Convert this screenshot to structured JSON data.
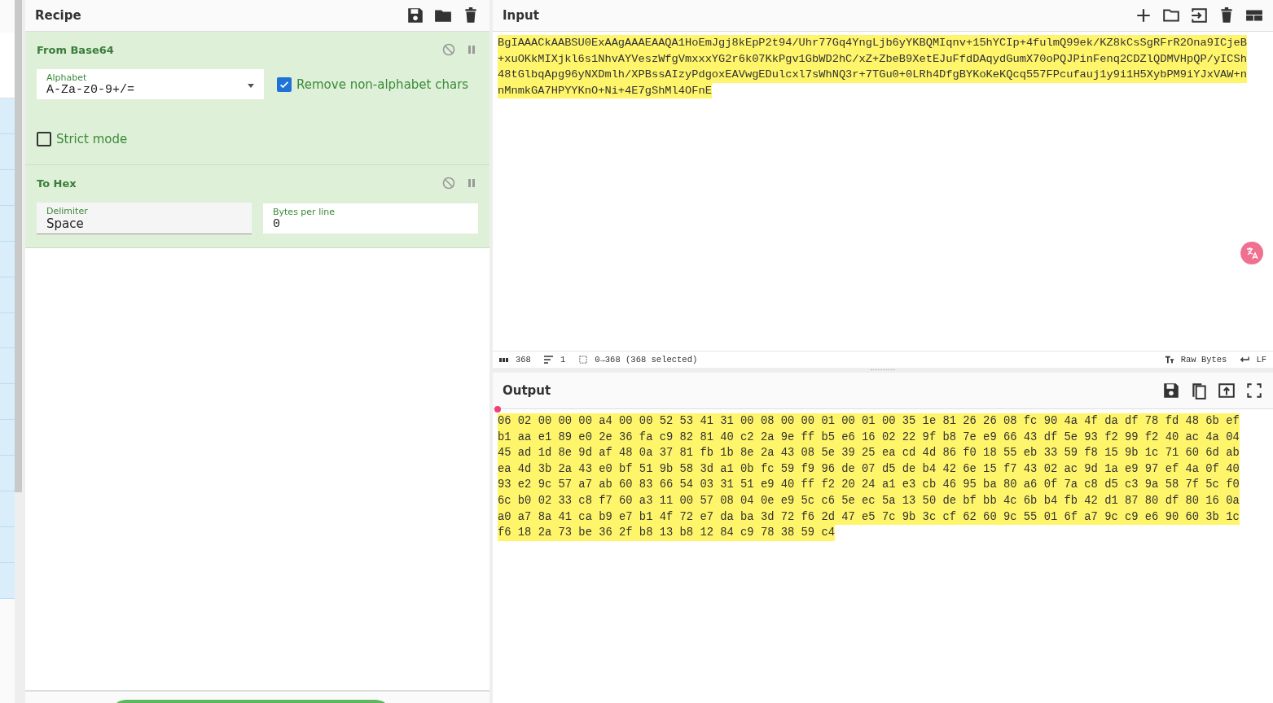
{
  "recipe": {
    "title": "Recipe",
    "operations": [
      {
        "name": "From Base64",
        "disabled": false,
        "paused": false,
        "fields": [
          {
            "kind": "select",
            "label": "Alphabet",
            "value": "A-Za-z0-9+/="
          },
          {
            "kind": "checkbox",
            "label": "Remove non-alphabet chars",
            "checked": true
          },
          {
            "kind": "checkbox",
            "label": "Strict mode",
            "checked": false
          }
        ]
      },
      {
        "name": "To Hex",
        "disabled": false,
        "paused": false,
        "fields": [
          {
            "kind": "dropdown",
            "label": "Delimiter",
            "value": "Space"
          },
          {
            "kind": "number",
            "label": "Bytes per line",
            "value": "0"
          }
        ]
      }
    ]
  },
  "input": {
    "title": "Input",
    "lines": [
      "BgIAAACkAABSU0ExAAgAAAEAAQA1HoEmJgj8kEpP2t94/Uhr77Gq4YngLjb6yYKBQMIqnv+15hYCIp+4fulmQ99ek/KZ8kCsSgRFrR2Ona9ICjeB",
      "+xuOKkMIXjkl6s1NhvAYVeszWfgVmxxxYG2r6k07KkPgv1GbWD2hC/xZ+ZbeB9XetEJuFfdDAqydGumX70oPQJPinFenq2CDZlQDMVHpQP/yICSh",
      "48tGlbqApg96yNXDmlh/XPBssAIzyPdgoxEAVwgEDulcxl7sWhNQ3r+7TGu0+0LRh4DfgBYKoKeKQcq557FPcufauj1y9i1H5XybPM9iYJxVAW+n",
      "nMnmkGA7HPYYKnO+Ni+4E7gShMl4OFnE"
    ]
  },
  "status_bar": {
    "length": "368",
    "lines": "1",
    "selection": "0→368 (368 selected)",
    "encoding": "Raw Bytes",
    "eol": "LF"
  },
  "output": {
    "title": "Output",
    "lines": [
      "06 02 00 00 00 a4 00 00 52 53 41 31 00 08 00 00 01 00 01 00 35 1e 81 26 26 08 fc 90 4a 4f da df 78 fd 48 6b ef",
      "b1 aa e1 89 e0 2e 36 fa c9 82 81 40 c2 2a 9e ff b5 e6 16 02 22 9f b8 7e e9 66 43 df 5e 93 f2 99 f2 40 ac 4a 04",
      "45 ad 1d 8e 9d af 48 0a 37 81 fb 1b 8e 2a 43 08 5e 39 25 ea cd 4d 86 f0 18 55 eb 33 59 f8 15 9b 1c 71 60 6d ab",
      "ea 4d 3b 2a 43 e0 bf 51 9b 58 3d a1 0b fc 59 f9 96 de 07 d5 de b4 42 6e 15 f7 43 02 ac 9d 1a e9 97 ef 4a 0f 40",
      "93 e2 9c 57 a7 ab 60 83 66 54 03 31 51 e9 40 ff f2 20 24 a1 e3 cb 46 95 ba 80 a6 0f 7a c8 d5 c3 9a 58 7f 5c f0",
      "6c b0 02 33 c8 f7 60 a3 11 00 57 08 04 0e e9 5c c6 5e ec 5a 13 50 de bf bb 4c 6b b4 fb 42 d1 87 80 df 80 16 0a",
      "a0 a7 8a 41 ca b9 e7 b1 4f 72 e7 da ba 3d 72 f6 2d 47 e5 7c 9b 3c cf 62 60 9c 55 01 6f a7 9c c9 e6 90 60 3b 1c",
      "f6 18 2a 73 be 36 2f b8 13 b8 12 84 c9 78 38 59 c4"
    ]
  }
}
